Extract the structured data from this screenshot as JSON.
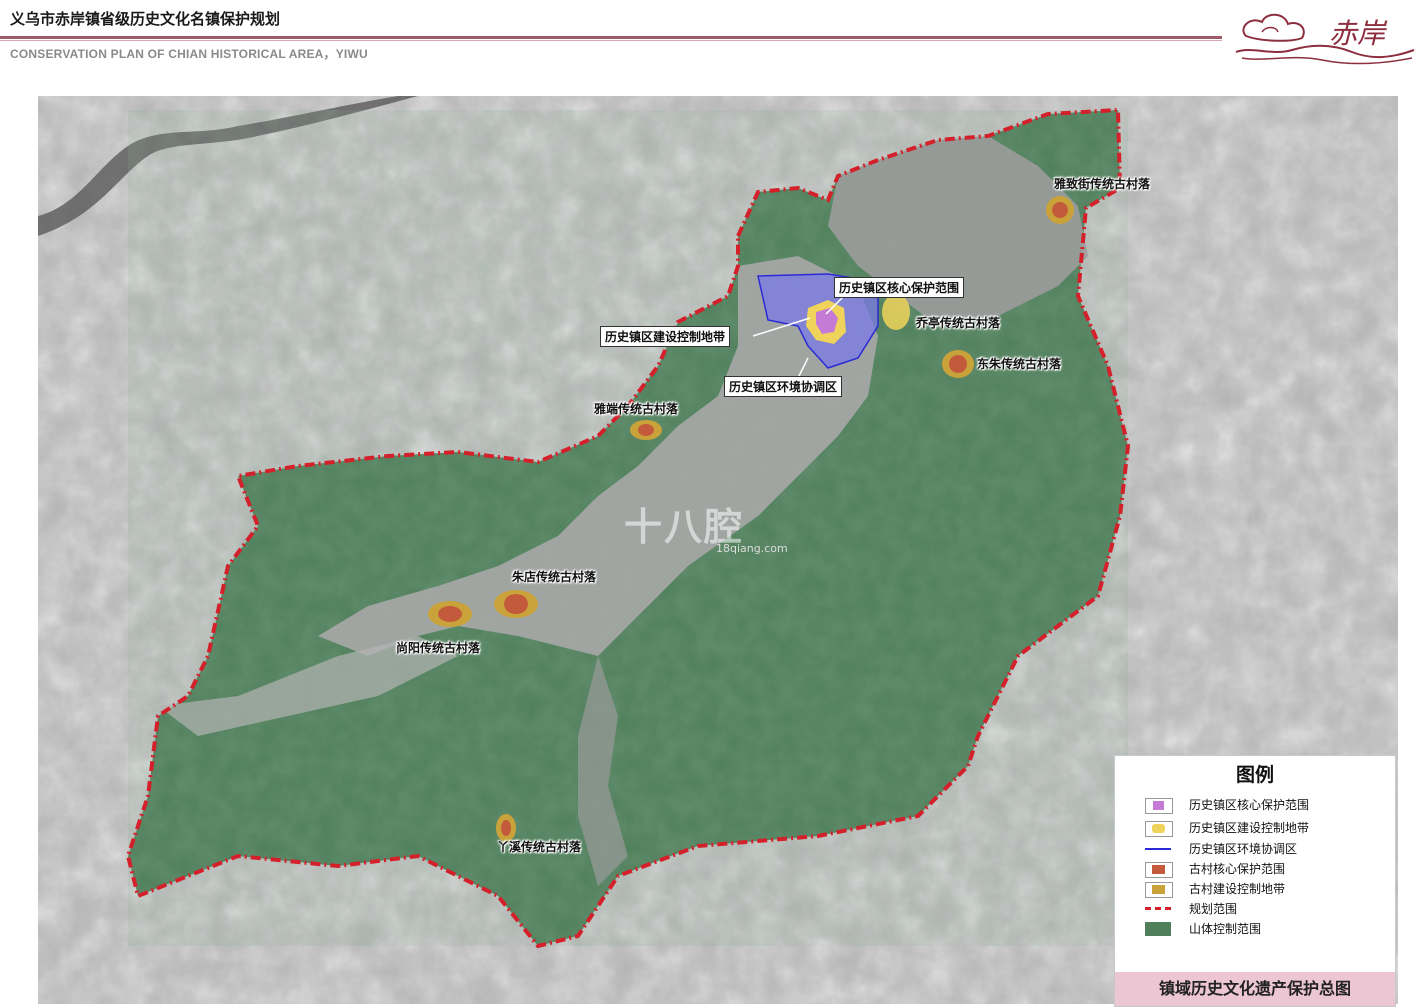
{
  "header": {
    "title_cn": "义乌市赤岸镇省级历史文化名镇保护规划",
    "title_en": "CONSERVATION PLAN OF CHIAN HISTORICAL AREA，YIWU",
    "logo_text": "赤岸"
  },
  "map": {
    "labels": {
      "core": "历史镇区核心保护范围",
      "buffer": "历史镇区建设控制地带",
      "env": "历史镇区环境协调区",
      "yazhijie": "雅致街传统古村落",
      "qiaoting": "乔亭传统古村落",
      "dongzhu": "东朱传统古村落",
      "yaduan": "雅端传统古村落",
      "zhudian": "朱店传统古村落",
      "shangyang": "尚阳传统古村落",
      "yaxi": "丫溪传统古村落"
    },
    "watermark": "十八腔",
    "watermark_url": "18qiang.com"
  },
  "legend": {
    "title": "图例",
    "items": [
      {
        "label": "历史镇区核心保护范围",
        "color": "#c57bd6"
      },
      {
        "label": "历史镇区建设控制地带",
        "color": "#f0d35a"
      },
      {
        "label": "历史镇区环境协调区",
        "color": "#2b2bd6"
      },
      {
        "label": "古村核心保护范围",
        "color": "#c45a3c"
      },
      {
        "label": "古村建设控制地带",
        "color": "#c9a23a"
      },
      {
        "label": "规划范围",
        "color": "#d4202a"
      },
      {
        "label": "山体控制范围",
        "color": "#4f7f5b"
      }
    ],
    "footer": "镇域历史文化遗产保护总图"
  },
  "colors": {
    "mountain": "#4f7f5b",
    "boundary": "#d4202a",
    "env_zone": "#7a7ae6",
    "satellite": "#b8b8b8"
  }
}
